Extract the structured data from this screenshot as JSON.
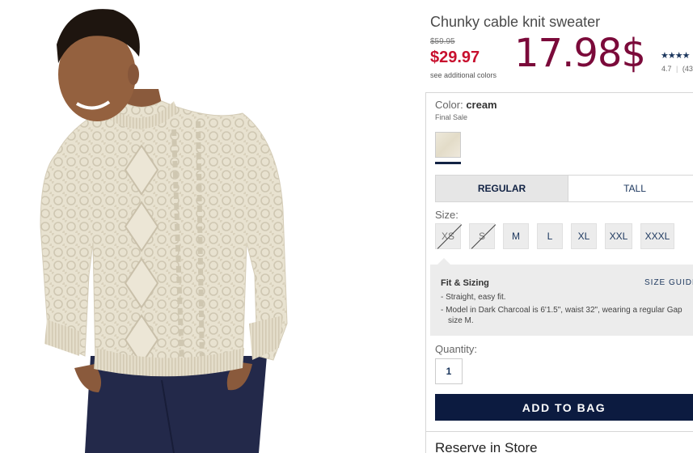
{
  "product": {
    "title": "Chunky cable knit sweater",
    "original_price": "$59.95",
    "sale_price": "$29.97",
    "see_colors": "see additional colors",
    "overlay_price": "17.98$",
    "stars": "★★★★",
    "rating": "4.7",
    "rating_sep": "|",
    "review_count": "(43"
  },
  "options": {
    "color_label": "Color:",
    "color_value": "cream",
    "final_sale": "Final Sale",
    "fit_tabs": [
      {
        "label": "REGULAR",
        "active": true
      },
      {
        "label": "TALL",
        "active": false
      }
    ],
    "size_label": "Size:",
    "sizes": [
      {
        "label": "XS",
        "available": false
      },
      {
        "label": "S",
        "available": false
      },
      {
        "label": "M",
        "available": true
      },
      {
        "label": "L",
        "available": true
      },
      {
        "label": "XL",
        "available": true
      },
      {
        "label": "XXL",
        "available": true
      },
      {
        "label": "XXXL",
        "available": true
      }
    ],
    "fit_title": "Fit & Sizing",
    "size_guide": "SIZE GUIDE",
    "fit_points": [
      "Straight, easy fit.",
      "Model in Dark Charcoal is 6'1.5\", waist 32\", wearing a regular Gap size M."
    ],
    "quantity_label": "Quantity:",
    "quantity_value": "1",
    "add_to_bag": "ADD TO BAG",
    "reserve": "Reserve in Store"
  },
  "colors": {
    "sale_red": "#c8102e",
    "overlay_price": "#7b0a3a",
    "navy": "#0c1b40",
    "sweater": "#e9e3d3"
  }
}
